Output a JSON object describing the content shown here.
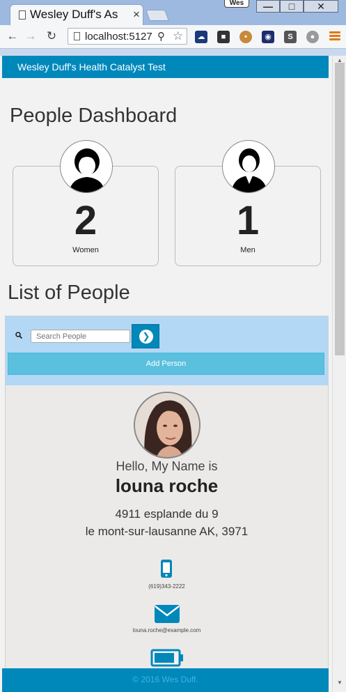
{
  "browser": {
    "tab_title": "Wesley Duff's As",
    "tab_close": "×",
    "profile_name": "Wes",
    "url": "localhost:5127"
  },
  "page": {
    "brand": "Wesley Duff's Health Catalyst Test",
    "dashboard_heading": "People Dashboard",
    "women_count": "2",
    "women_label": "Women",
    "men_count": "1",
    "men_label": "Men",
    "list_heading": "List of People",
    "search_placeholder": "Search People",
    "add_person_label": "Add Person",
    "footer": "© 2016 Wes Duff."
  },
  "person": {
    "greeting": "Hello, My Name is",
    "name": "louna roche",
    "street": "4911 esplande du 9",
    "city_line": "le mont-sur-lausanne AK, 3971",
    "phone": "(619)343-2222",
    "email": "louna.roche@example.com"
  },
  "colors": {
    "brand_blue": "#0088bb",
    "add_button": "#5bc0de",
    "search_bg": "#b3d8f5"
  }
}
